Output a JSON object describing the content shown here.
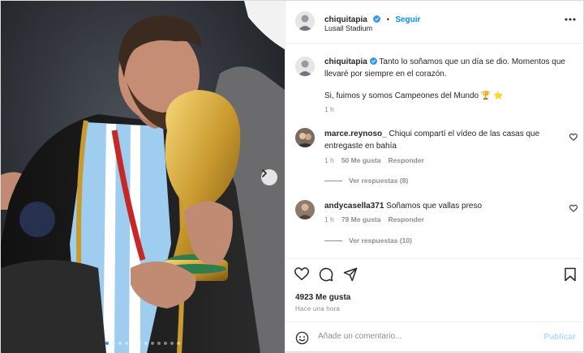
{
  "header": {
    "username": "chiquitapia",
    "separator": "•",
    "follow_label": "Seguir",
    "location": "Lusail Stadium",
    "more_icon": "more-horizontal-icon"
  },
  "caption": {
    "username": "chiquitapia",
    "text_line1": "Tanto lo soñamos que un día se dio. Momentos que",
    "text_line2": "llevaré por siempre en el corazón.",
    "text_line3": "Si, fuimos y somos Campeones del Mundo 🏆 ⭐",
    "time": "1 h"
  },
  "comments": [
    {
      "username": "marce.reynoso_",
      "text_line1": "Chiqui compartí el vídeo de las casas que",
      "text_line2": "entregaste en bahía",
      "time": "1 h",
      "likes": "50 Me gusta",
      "reply_label": "Responder",
      "view_replies": "Ver respuestas (8)"
    },
    {
      "username": "andycasella371",
      "text_line1": "Soñamos que vallas preso",
      "time": "1 h",
      "likes": "79 Me gusta",
      "reply_label": "Responder",
      "view_replies": "Ver respuestas (10)"
    }
  ],
  "actions": {
    "like_icon": "heart-icon",
    "comment_icon": "comment-icon",
    "share_icon": "send-icon",
    "save_icon": "bookmark-icon",
    "likes_count": "4923 Me gusta",
    "time_ago": "Hace una hora"
  },
  "composer": {
    "emoji_icon": "emoji-icon",
    "placeholder": "Añade un comentario...",
    "value": "",
    "publish_label": "Publicar"
  },
  "media": {
    "carousel_index": 1,
    "carousel_total": 12,
    "next_icon": "chevron-right-icon"
  },
  "colors": {
    "accent": "#0095f6",
    "verified": "#3897f0",
    "publish_disabled": "#b3dbff"
  }
}
